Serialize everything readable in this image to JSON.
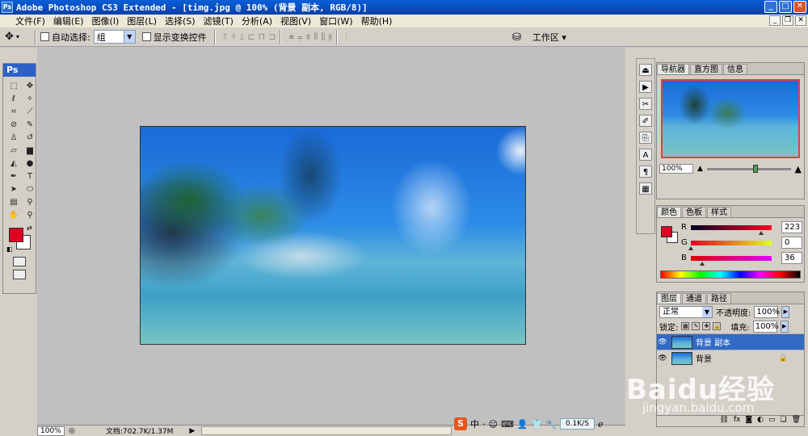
{
  "window": {
    "title": "Adobe Photoshop CS3 Extended - [timg.jpg @ 100% (背景 副本, RGB/8)]",
    "app_icon": "Ps",
    "controls": {
      "minimize": "_",
      "maximize": "□",
      "close": "✕"
    }
  },
  "menu": {
    "items": [
      "文件(F)",
      "编辑(E)",
      "图像(I)",
      "图层(L)",
      "选择(S)",
      "滤镜(T)",
      "分析(A)",
      "视图(V)",
      "窗口(W)",
      "帮助(H)"
    ],
    "doc_controls": {
      "minimize": "_",
      "restore": "❐",
      "close": "✕"
    }
  },
  "options_bar": {
    "auto_select_label": "自动选择:",
    "auto_select_value": "组",
    "show_transform_label": "显示变换控件",
    "workspace_label": "工作区"
  },
  "toolbox": {
    "logo": "Ps"
  },
  "colors": {
    "foreground": "#df0024",
    "background": "#ffffff",
    "accent": "#316ac5"
  },
  "status": {
    "zoom": "100%",
    "doc_info": "文档:702.7K/1.37M"
  },
  "navigator_panel": {
    "tabs": [
      "导航器",
      "直方图",
      "信息"
    ],
    "zoom": "100%"
  },
  "color_panel": {
    "tabs": [
      "颜色",
      "色板",
      "样式"
    ],
    "channels": [
      {
        "label": "R",
        "value": "223",
        "fraction": 0.87
      },
      {
        "label": "G",
        "value": "0",
        "fraction": 0.0
      },
      {
        "label": "B",
        "value": "36",
        "fraction": 0.14
      }
    ]
  },
  "layers_panel": {
    "tabs": [
      "图层",
      "通道",
      "路径"
    ],
    "blend_mode": "正常",
    "opacity_label": "不透明度:",
    "opacity": "100%",
    "lock_label": "锁定:",
    "fill_label": "填充:",
    "fill": "100%",
    "layers": [
      {
        "name": "背景 副本",
        "selected": true,
        "locked": false
      },
      {
        "name": "背景",
        "selected": false,
        "locked": true
      }
    ]
  },
  "tray": {
    "ime": "中",
    "speed": "0.1K/S"
  },
  "watermark": {
    "brand": "Baidu经验",
    "url": "jingyan.baidu.com"
  }
}
